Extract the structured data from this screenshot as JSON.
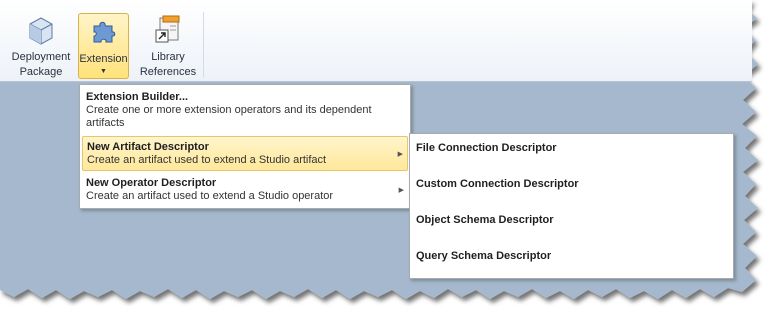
{
  "ribbon": {
    "buttons": [
      {
        "label_line1": "Deployment",
        "label_line2": "Package",
        "icon": "deployment-package-icon"
      },
      {
        "label_line1": "Extension",
        "caret": "▼",
        "icon": "puzzle-piece-icon"
      },
      {
        "label_line1": "Library",
        "label_line2": "References",
        "icon": "library-references-icon"
      }
    ]
  },
  "extension_menu": {
    "items": [
      {
        "title": "Extension Builder...",
        "desc": "Create one or more extension operators and its dependent artifacts"
      },
      {
        "title": "New Artifact Descriptor",
        "desc": "Create an artifact used to extend a Studio artifact",
        "submenu_arrow": "▶"
      },
      {
        "title": "New Operator Descriptor",
        "desc": "Create an artifact used to extend a Studio operator",
        "submenu_arrow": "▶"
      }
    ]
  },
  "artifact_submenu": {
    "items": [
      "File Connection Descriptor",
      "Custom Connection Descriptor",
      "Object Schema Descriptor",
      "Query Schema Descriptor"
    ]
  },
  "colors": {
    "canvas": "#a5b8cd",
    "hover_bg": "#ffe89a",
    "ribbon_active": "#ffe27a"
  }
}
